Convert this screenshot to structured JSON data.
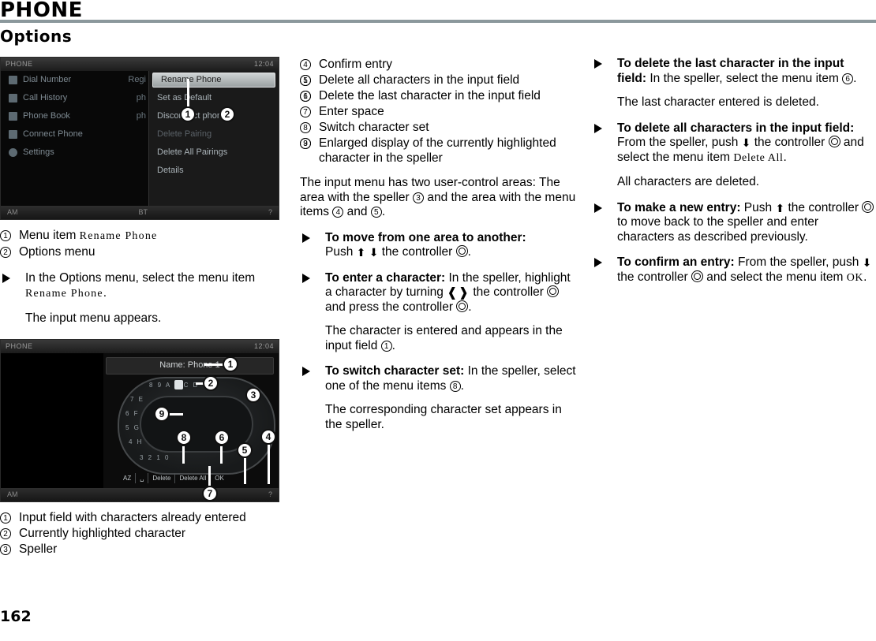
{
  "header": {
    "title": "PHONE",
    "section": "Options"
  },
  "page_number": "162",
  "screenshot1": {
    "status_left": "PHONE",
    "status_right": "12:04",
    "bottom_left": "AM",
    "bottom_bluetooth": "BT",
    "bottom_right": "?",
    "menu_items": [
      "Dial Number",
      "Call History",
      "Phone Book",
      "Connect Phone",
      "Settings"
    ],
    "menu_values": [
      "Regi",
      "ph",
      "ph",
      "",
      ""
    ],
    "options_menu": [
      "Rename Phone",
      "Set as Default",
      "Disconnect phone",
      "Delete Pairing",
      "Delete All Pairings",
      "Details"
    ],
    "callouts": [
      "1",
      "2"
    ]
  },
  "legend1": [
    {
      "num": "1",
      "text": "Menu item ",
      "mono": "Rename Phone"
    },
    {
      "num": "2",
      "text": "Options menu",
      "mono": ""
    }
  ],
  "step1": {
    "lead": "In the Options menu, select the menu item ",
    "mono": "Rename Phone",
    "tail": ".",
    "result": "The input menu appears."
  },
  "screenshot2": {
    "status_left": "PHONE",
    "status_right": "12:04",
    "input_field": "Name: Phone 1",
    "bottom_left": "AM",
    "bottom_right": "?",
    "speller_rows": [
      "8 9 A B C D",
      "7 E",
      "6 F",
      "5 G",
      "4 H",
      "3 2 1 0"
    ],
    "menu_bar": [
      "AZ",
      "␣",
      "Delete",
      "Delete All",
      "OK"
    ],
    "callouts": [
      "1",
      "2",
      "3",
      "4",
      "5",
      "6",
      "7",
      "8",
      "9"
    ]
  },
  "legend2": [
    {
      "num": "1",
      "text": "Input field with characters already entered"
    },
    {
      "num": "2",
      "text": "Currently highlighted character"
    },
    {
      "num": "3",
      "text": "Speller"
    }
  ],
  "legend3": [
    {
      "num": "4",
      "text": "Confirm entry"
    },
    {
      "num": "5",
      "text": "Delete all characters in the input field"
    },
    {
      "num": "6",
      "text": "Delete the last character in the input field"
    },
    {
      "num": "7",
      "text": "Enter space"
    },
    {
      "num": "8",
      "text": "Switch character set"
    },
    {
      "num": "9",
      "text": "Enlarged display of the currently highlighted character in the speller"
    }
  ],
  "col2": {
    "intro": "The input menu has two user-control areas: The area with the speller ③ and the area with the menu items ④ and ⑤.",
    "intro_a": "The input menu has two user-control areas: The area with the speller ",
    "intro_b": " and the area with the menu items ",
    "intro_c": " and ",
    "intro_d": ".",
    "b1_title": "To move from one area to another:",
    "b1_text_a": "Push ",
    "b1_text_b": " the controller ",
    "b1_text_c": ".",
    "b2_title": "To enter a character:",
    "b2_a": " In the speller, highlight a character by turning ",
    "b2_b": " the controller ",
    "b2_c": " and press the controller ",
    "b2_d": ".",
    "b2_result_a": "The character is entered and appears in the input field ",
    "b2_result_b": ".",
    "b3_title": "To switch character set:",
    "b3_a": " In the speller, select one of the menu items ",
    "b3_b": ".",
    "b3_result": "The corresponding character set appears in the speller."
  },
  "col3": {
    "b1_title": "To delete the last character in the input field:",
    "b1_a": " In the speller, select the menu item ",
    "b1_b": ".",
    "b1_result": "The last character entered is deleted.",
    "b2_title": "To delete all characters in the input field:",
    "b2_a": " From the speller, push ",
    "b2_b": " the controller ",
    "b2_c": " and select the menu item ",
    "b2_mono": "Delete All",
    "b2_d": ".",
    "b2_result": "All characters are deleted.",
    "b3_title": "To make a new entry:",
    "b3_a": " Push ",
    "b3_b": " the controller ",
    "b3_c": " to move back to the speller and enter characters as described previously.",
    "b4_title": "To confirm an entry:",
    "b4_a": " From the speller, push ",
    "b4_b": " the controller ",
    "b4_c": " and select the menu item ",
    "b4_mono": "OK",
    "b4_d": "."
  },
  "glyphs": {
    "up": "⬆",
    "down": "⬇",
    "turn_left": "❰",
    "turn_right": "❱"
  }
}
